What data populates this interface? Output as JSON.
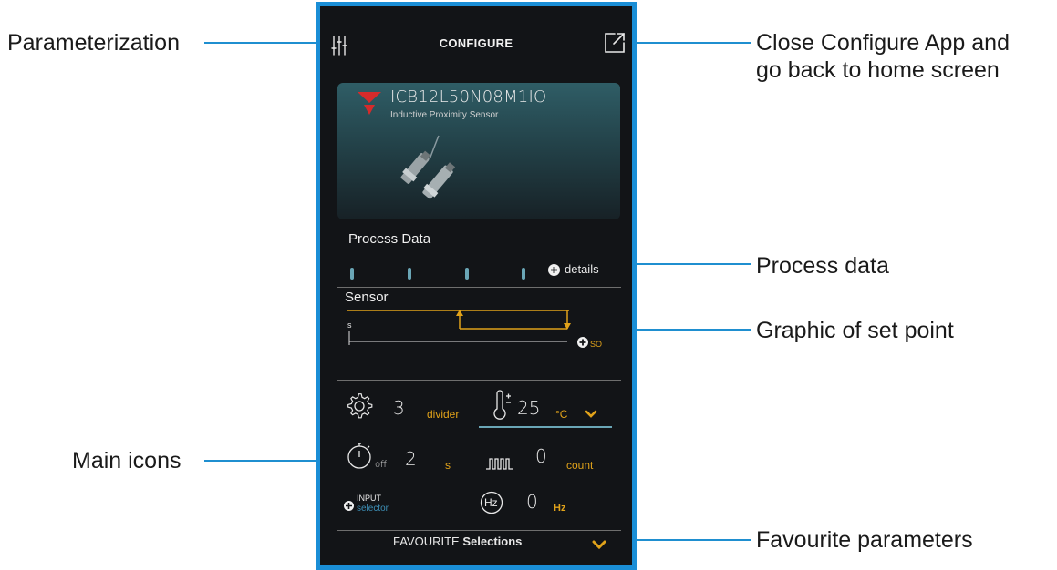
{
  "callouts": {
    "parameterization": "Parameterization",
    "close_line1": "Close Configure App and",
    "close_line2": "go back to home screen",
    "process_data": "Process data",
    "graphic": "Graphic of set point",
    "main_icons": "Main icons",
    "favourite": "Favourite parameters"
  },
  "app": {
    "title": "CONFIGURE",
    "product": {
      "model": "ICB12L50N08M1IO",
      "type": "Inductive Proximity Sensor"
    },
    "process_section": "Process Data",
    "details_label": "details",
    "sensor_section": "Sensor",
    "graph": {
      "axis_label": "s",
      "setpoint_label": "SO"
    },
    "params": {
      "divider": {
        "value": "3",
        "unit": "divider"
      },
      "temperature": {
        "value": "25",
        "unit": "°C"
      },
      "timer": {
        "sub": "off",
        "value": "2",
        "unit": "s"
      },
      "counter": {
        "value": "0",
        "unit": "count"
      },
      "input": {
        "label": "INPUT",
        "sub": "selector"
      },
      "frequency": {
        "icon_text": "Hz",
        "value": "0",
        "unit": "Hz"
      }
    },
    "favourites": {
      "prefix": "FAVOURITE",
      "bold": "Selections"
    }
  },
  "colors": {
    "accent": "#e0a21a",
    "border": "#1a8ed6",
    "teal": "#6aa6b6"
  }
}
